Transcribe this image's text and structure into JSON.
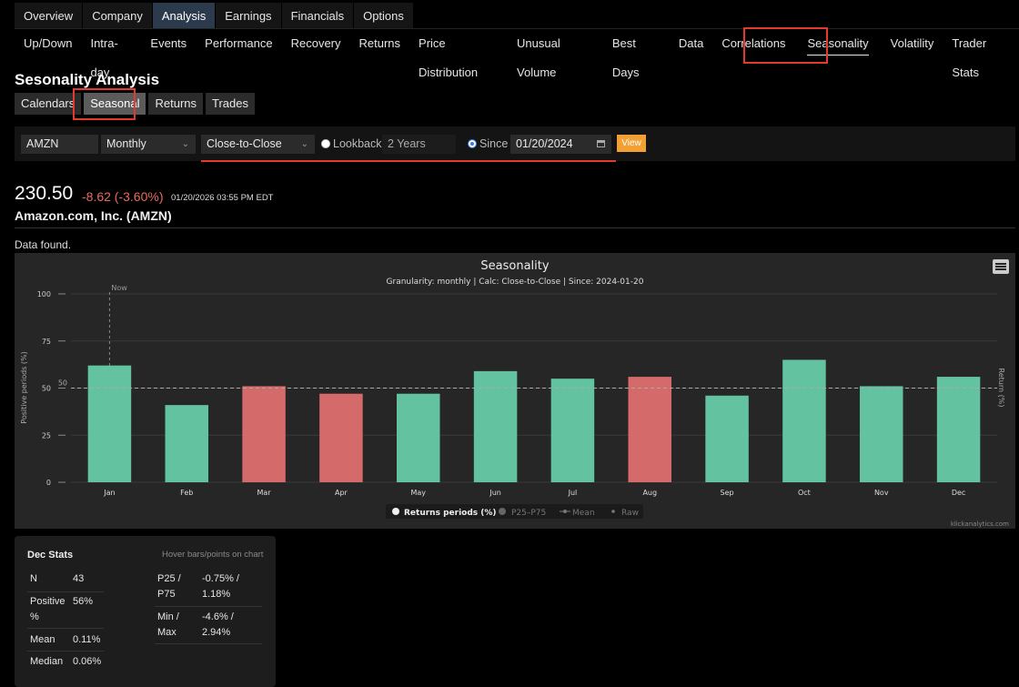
{
  "tabs_primary": [
    "Overview",
    "Company",
    "Analysis",
    "Earnings",
    "Financials",
    "Options"
  ],
  "tabs_secondary": [
    "Up/Down",
    "Intra-day",
    "Events",
    "Performance",
    "Recovery",
    "Returns",
    "Price Distribution",
    "Unusual Volume",
    "Best Days",
    "Data",
    "Correlations",
    "Seasonality",
    "Volatility",
    "Trader Stats"
  ],
  "page_title": "Sesonality Analysis",
  "subtabs": [
    "Calendars",
    "Seasonal",
    "Returns",
    "Trades"
  ],
  "controls": {
    "ticker": "AMZN",
    "granularity": "Monthly",
    "calc": "Close-to-Close",
    "lookback_label": "Lookback",
    "lookback_value": "2 Years",
    "since_label": "Since",
    "since_date": "01/20/2024",
    "view_label": "View"
  },
  "quote": {
    "price": "230.50",
    "change": "-8.62 (-3.60%)",
    "timestamp": "01/20/2026 03:55 PM EDT",
    "company": "Amazon.com, Inc. (AMZN)"
  },
  "status": "Data found.",
  "chart_data": {
    "type": "bar",
    "title": "Seasonality",
    "subtitle": "Granularity: monthly | Calc: Close-to-Close | Since: 2024-01-20",
    "categories": [
      "Jan",
      "Feb",
      "Mar",
      "Apr",
      "May",
      "Jun",
      "Jul",
      "Aug",
      "Sep",
      "Oct",
      "Nov",
      "Dec"
    ],
    "values": [
      62,
      41,
      51,
      47,
      47,
      59,
      55,
      56,
      46,
      65,
      51,
      56
    ],
    "bar_colors": [
      "#63c3a0",
      "#63c3a0",
      "#d46a69",
      "#d46a69",
      "#63c3a0",
      "#63c3a0",
      "#63c3a0",
      "#d46a69",
      "#63c3a0",
      "#63c3a0",
      "#63c3a0",
      "#63c3a0"
    ],
    "ylabel": "Positive periods (%)",
    "ylabel_right": "Return (%)",
    "ylim": [
      0,
      100
    ],
    "yticks": [
      "0",
      "25",
      "50",
      "75",
      "100"
    ],
    "reference_label": "50",
    "now_label": "Now",
    "legend": [
      "Returns periods (%)",
      "P25–P75",
      "Mean",
      "Raw"
    ],
    "legend_position": "bottom-center",
    "credit": "klickanalytics.com"
  },
  "stats": {
    "heading": "Dec Stats",
    "hint": "Hover bars/points on chart",
    "n_label": "N",
    "n_value": "43",
    "positive_label_1": "Positive",
    "positive_label_2": "%",
    "positive_value": "56%",
    "mean_label": "Mean",
    "mean_value": "0.11%",
    "median_label": "Median",
    "median_value": "0.06%",
    "p_label_1": "P25 /",
    "p_label_2": "P75",
    "p_value_1": "-0.75% /",
    "p_value_2": "1.18%",
    "mm_label_1": "Min /",
    "mm_label_2": "Max",
    "mm_value_1": "-4.6% /",
    "mm_value_2": "2.94%"
  },
  "colors": {
    "positive_bar": "#63c3a0",
    "negative_bar": "#d46a69",
    "change_negative": "#e86a61",
    "highlight": "#e23a32",
    "view_button": "#f2a033"
  }
}
